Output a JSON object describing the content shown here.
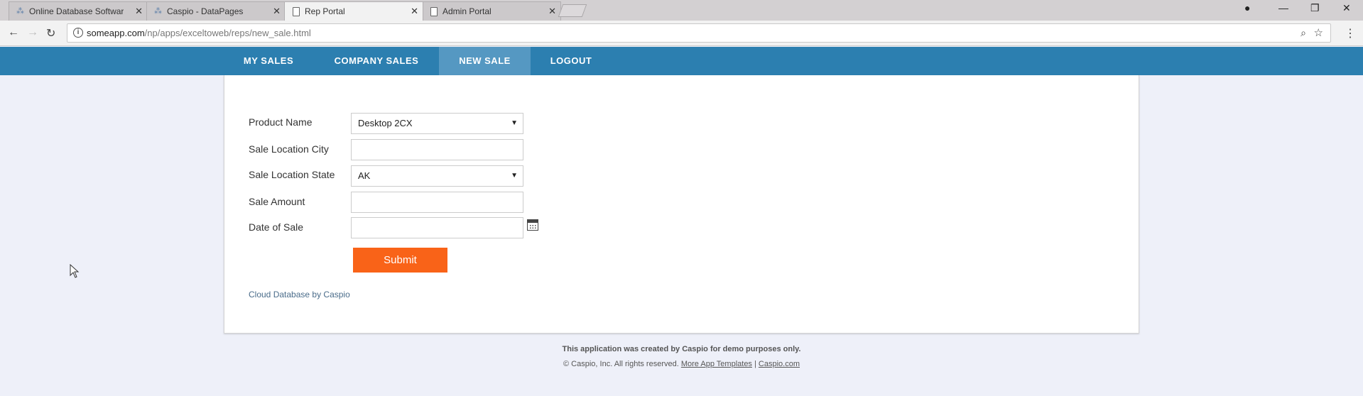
{
  "tabs": [
    {
      "title": "Online Database Softwar",
      "icon": "caspio-icon"
    },
    {
      "title": "Caspio - DataPages",
      "icon": "caspio-icon"
    },
    {
      "title": "Rep Portal",
      "icon": "page-icon"
    },
    {
      "title": "Admin Portal",
      "icon": "page-icon"
    }
  ],
  "address": {
    "host": "someapp.com",
    "path": "/np/apps/exceltoweb/reps/new_sale.html"
  },
  "nav": {
    "items": [
      "MY SALES",
      "COMPANY SALES",
      "NEW SALE",
      "LOGOUT"
    ],
    "active": "NEW SALE"
  },
  "form": {
    "product_label": "Product Name",
    "product_value": "Desktop 2CX",
    "city_label": "Sale Location City",
    "city_value": "",
    "state_label": "Sale Location State",
    "state_value": "AK",
    "amount_label": "Sale Amount",
    "amount_value": "",
    "date_label": "Date of Sale",
    "date_value": "",
    "submit_label": "Submit",
    "credit": "Cloud Database by Caspio"
  },
  "footer": {
    "line1": "This application was created by Caspio for demo purposes only.",
    "copyright": "© Caspio, Inc. All rights reserved.",
    "link1": "More App Templates",
    "separator": "|",
    "link2": "Caspio.com"
  },
  "colors": {
    "nav_bg": "#2c7fb0",
    "nav_active": "#5598c2",
    "submit": "#f96318",
    "page_bg": "#eef0f9"
  }
}
